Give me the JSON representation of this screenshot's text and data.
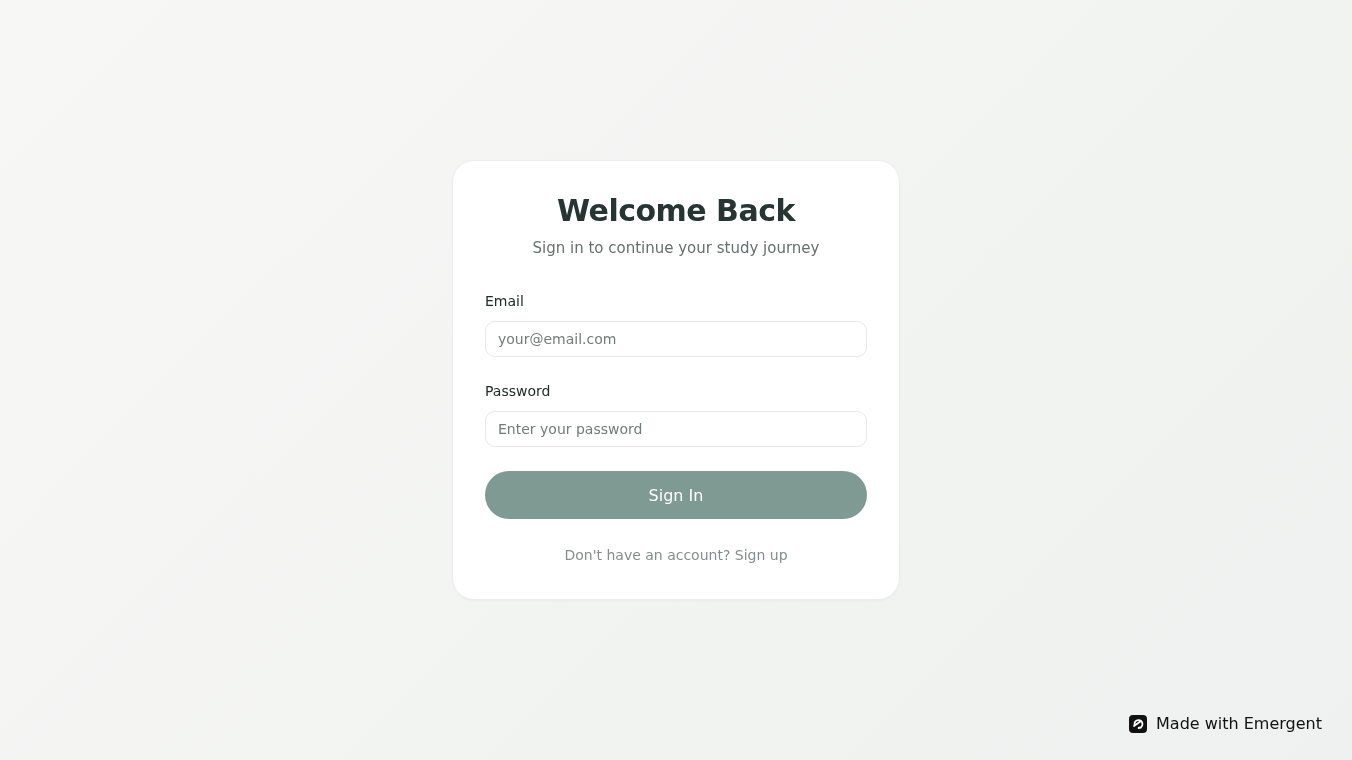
{
  "card": {
    "title": "Welcome Back",
    "subtitle": "Sign in to continue your study journey",
    "fields": [
      {
        "label": "Email",
        "placeholder": "your@email.com"
      },
      {
        "label": "Password",
        "placeholder": "Enter your password"
      }
    ],
    "button": "Sign In",
    "footer": {
      "text": "Don't have an account?",
      "link": "Sign up"
    }
  },
  "badge": {
    "text": "Made with Emergent"
  }
}
